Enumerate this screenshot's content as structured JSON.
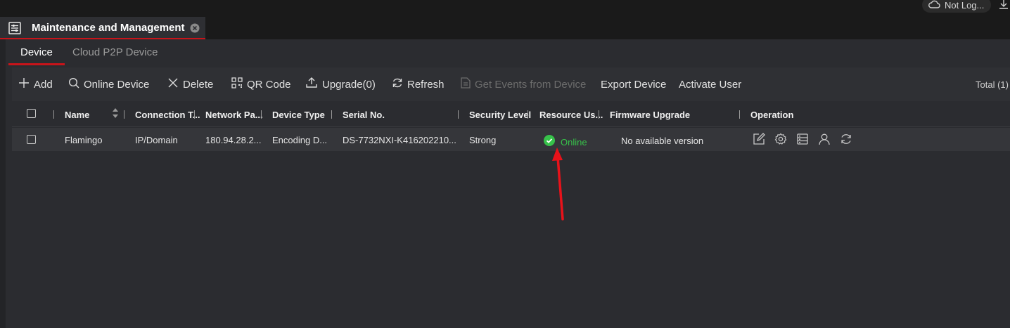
{
  "topbar": {
    "login_status": "Not Log...",
    "icons": [
      "cloud-icon",
      "download-icon"
    ]
  },
  "window_tab": {
    "title": "Maintenance and Management"
  },
  "subtabs": [
    {
      "label": "Device",
      "active": true
    },
    {
      "label": "Cloud P2P Device",
      "active": false
    }
  ],
  "toolbar": {
    "add": "Add",
    "online_device": "Online Device",
    "delete": "Delete",
    "qr_code": "QR Code",
    "upgrade": "Upgrade(0)",
    "refresh": "Refresh",
    "get_events": "Get Events from Device",
    "export_device": "Export Device",
    "activate_user": "Activate User",
    "total": "Total (1)"
  },
  "table": {
    "columns": [
      "Name",
      "Connection T...",
      "Network Pa...",
      "Device Type",
      "Serial No.",
      "Security Level",
      "Resource Us...",
      "Firmware Upgrade",
      "Operation"
    ],
    "rows": [
      {
        "name": "Flamingo",
        "connection": "IP/Domain",
        "network": "180.94.28.2...",
        "device_type": "Encoding D...",
        "serial": "DS-7732NXI-K416202210...",
        "security": "Strong",
        "status": "Online",
        "firmware": "No available version"
      }
    ],
    "operation_icons": [
      "edit-icon",
      "settings-icon",
      "remote-config-icon",
      "user-icon",
      "refresh-icon"
    ]
  },
  "colors": {
    "accent_red": "#c8141a",
    "online_green": "#37c24a",
    "panel_bg": "#2b2c30"
  }
}
